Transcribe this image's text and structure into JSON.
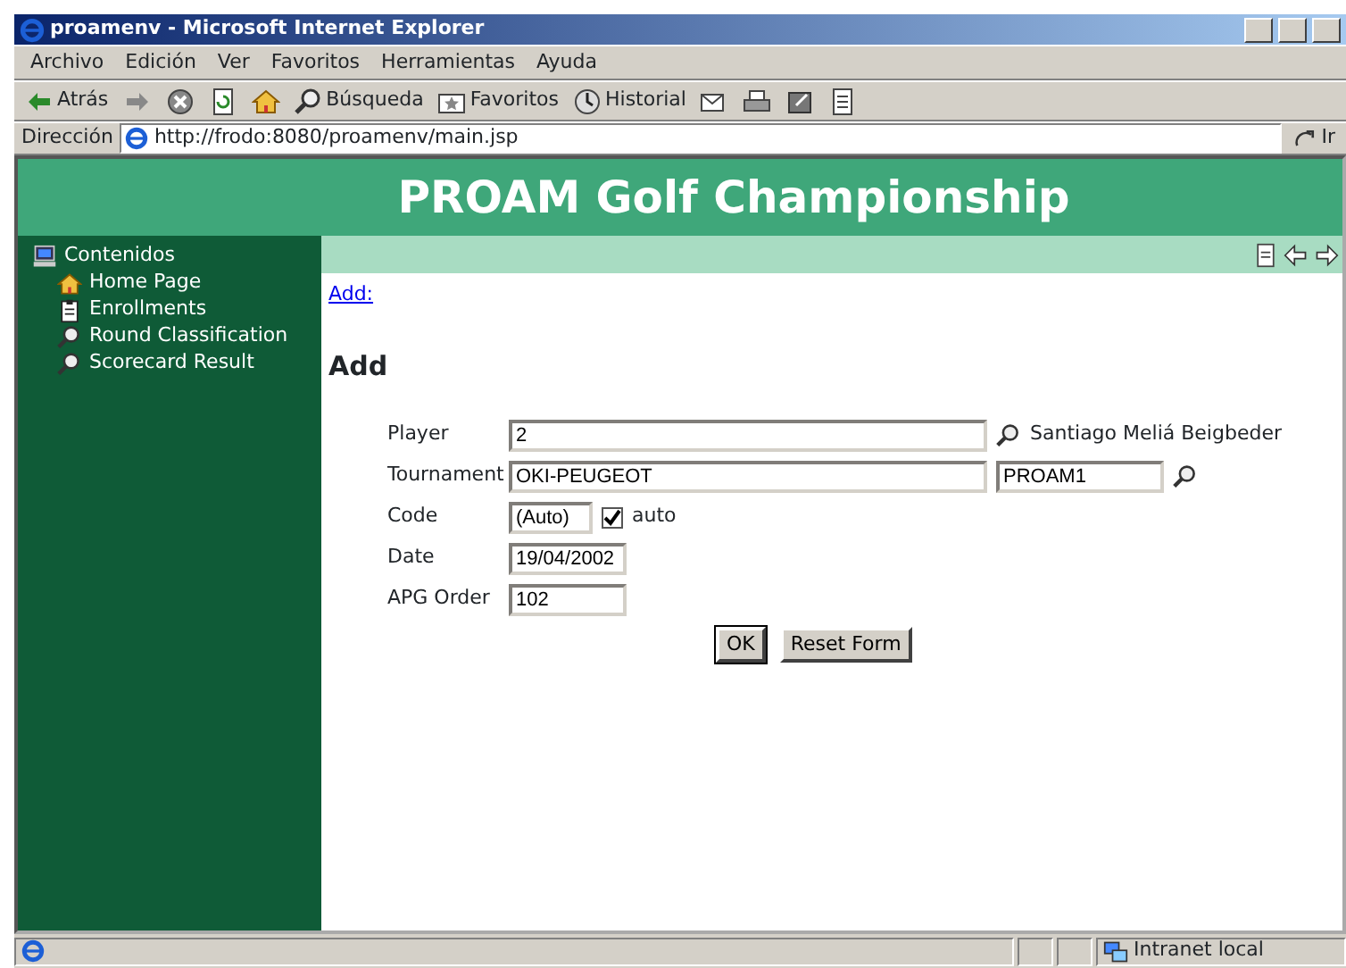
{
  "window": {
    "title": "proamenv - Microsoft Internet Explorer"
  },
  "menu": [
    "Archivo",
    "Edición",
    "Ver",
    "Favoritos",
    "Herramientas",
    "Ayuda"
  ],
  "toolbar": [
    {
      "kind": "back",
      "label": "Atrás"
    },
    {
      "kind": "forward"
    },
    {
      "kind": "stop"
    },
    {
      "kind": "refresh"
    },
    {
      "kind": "home"
    },
    {
      "kind": "search",
      "label": "Búsqueda"
    },
    {
      "kind": "favorites",
      "label": "Favoritos"
    },
    {
      "kind": "history",
      "label": "Historial"
    },
    {
      "kind": "mail"
    },
    {
      "kind": "print"
    },
    {
      "kind": "edit"
    },
    {
      "kind": "discuss"
    }
  ],
  "address": {
    "label": "Dirección",
    "value": "http://frodo:8080/proamenv/main.jsp",
    "go": "Ir"
  },
  "banner": "PROAM Golf Championship",
  "sidebar": {
    "root": "Contenidos",
    "children": [
      {
        "label": "Home Page",
        "kind": "home"
      },
      {
        "label": "Enrollments",
        "kind": "clipboard"
      },
      {
        "label": "Round Classification",
        "kind": "search"
      },
      {
        "label": "Scorecard Result",
        "kind": "search"
      }
    ]
  },
  "breadcrumb": "Add:",
  "heading": "Add",
  "form": {
    "rows": [
      {
        "label": "Player",
        "fields": [
          {
            "value": "2",
            "kind": "long"
          }
        ],
        "lookup": true,
        "note": "Santiago Meliá Beigbeder"
      },
      {
        "label": "Tournament",
        "fields": [
          {
            "value": "OKI-PEUGEOT",
            "kind": "long"
          },
          {
            "value": "PROAM1",
            "kind": "medium"
          }
        ],
        "lookup": true
      },
      {
        "label": "Code",
        "fields": [
          {
            "value": "(Auto)",
            "kind": "tiny"
          }
        ],
        "checkbox": {
          "label": "auto",
          "checked": true
        }
      },
      {
        "label": "Date",
        "fields": [
          {
            "value": "19/04/2002",
            "kind": "short"
          }
        ]
      },
      {
        "label": "APG Order",
        "fields": [
          {
            "value": "102",
            "kind": "short"
          }
        ]
      }
    ],
    "buttons": [
      {
        "label": "OK",
        "focused": true
      },
      {
        "label": "Reset Form",
        "focused": false
      }
    ]
  },
  "status_bar": {
    "zone": "Intranet local"
  }
}
